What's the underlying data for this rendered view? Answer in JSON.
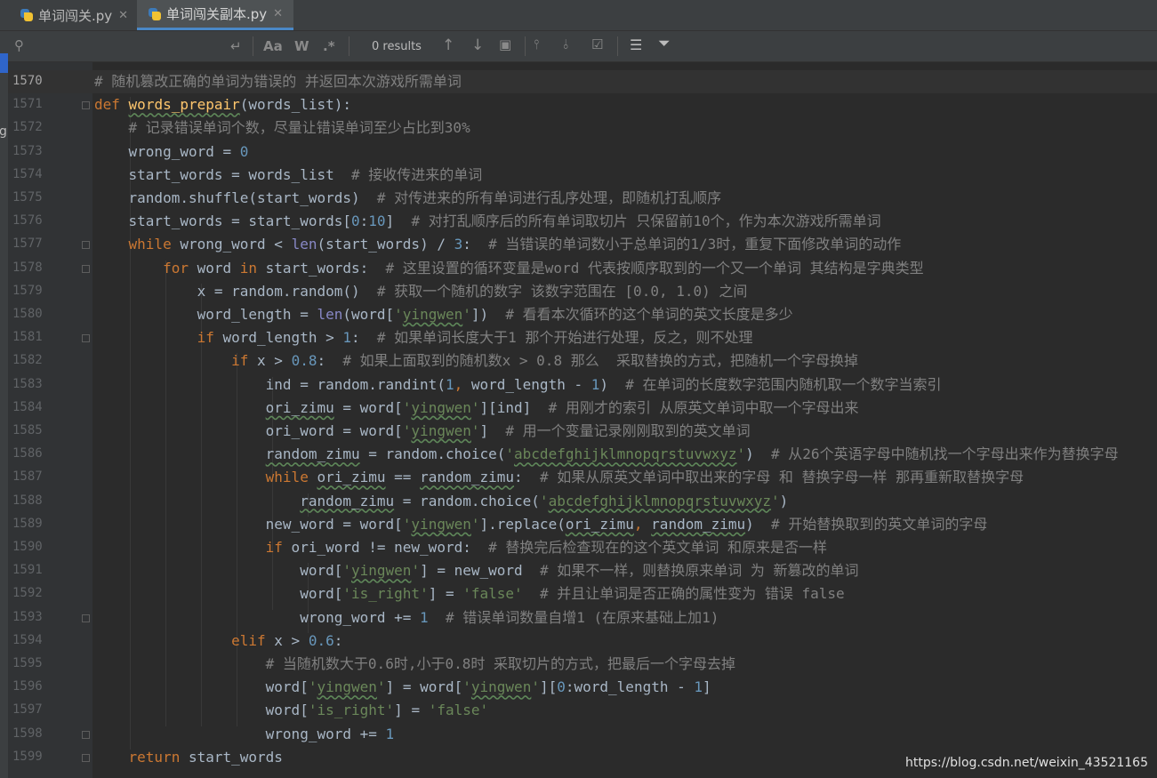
{
  "tabs": [
    {
      "label": "单词闯关.py",
      "active": false
    },
    {
      "label": "单词闯关副本.py",
      "active": true
    }
  ],
  "find": {
    "results": "0 results",
    "match_case": "Aa",
    "words": "W",
    "regex": ".*"
  },
  "left_strip_char": "g",
  "lines": [
    {
      "no": "1570",
      "code": "# 随机篡改正确的单词为错误的 并返回本次游戏所需单词"
    },
    {
      "no": "1571",
      "code": "def words_prepair(words_list):"
    },
    {
      "no": "1572",
      "code": "    # 记录错误单词个数，尽量让错误单词至少占比到30%"
    },
    {
      "no": "1573",
      "code": "    wrong_word = 0"
    },
    {
      "no": "1574",
      "code": "    start_words = words_list  # 接收传进来的单词"
    },
    {
      "no": "1575",
      "code": "    random.shuffle(start_words)  # 对传进来的所有单词进行乱序处理，即随机打乱顺序"
    },
    {
      "no": "1576",
      "code": "    start_words = start_words[0:10]  # 对打乱顺序后的所有单词取切片 只保留前10个，作为本次游戏所需单词"
    },
    {
      "no": "1577",
      "code": "    while wrong_word < len(start_words) / 3:  # 当错误的单词数小于总单词的1/3时，重复下面修改单词的动作"
    },
    {
      "no": "1578",
      "code": "        for word in start_words:  # 这里设置的循环变量是word 代表按顺序取到的一个又一个单词 其结构是字典类型"
    },
    {
      "no": "1579",
      "code": "            x = random.random()  # 获取一个随机的数字 该数字范围在 [0.0, 1.0) 之间"
    },
    {
      "no": "1580",
      "code": "            word_length = len(word['yingwen'])  # 看看本次循环的这个单词的英文长度是多少"
    },
    {
      "no": "1581",
      "code": "            if word_length > 1:  # 如果单词长度大于1 那个开始进行处理，反之，则不处理"
    },
    {
      "no": "1582",
      "code": "                if x > 0.8:  # 如果上面取到的随机数x > 0.8 那么  采取替换的方式，把随机一个字母换掉"
    },
    {
      "no": "1583",
      "code": "                    ind = random.randint(1, word_length - 1)  # 在单词的长度数字范围内随机取一个数字当索引"
    },
    {
      "no": "1584",
      "code": "                    ori_zimu = word['yingwen'][ind]  # 用刚才的索引 从原英文单词中取一个字母出来"
    },
    {
      "no": "1585",
      "code": "                    ori_word = word['yingwen']  # 用一个变量记录刚刚取到的英文单词"
    },
    {
      "no": "1586",
      "code": "                    random_zimu = random.choice('abcdefghijklmnopqrstuvwxyz')  # 从26个英语字母中随机找一个字母出来作为替换字母"
    },
    {
      "no": "1587",
      "code": "                    while ori_zimu == random_zimu:  # 如果从原英文单词中取出来的字母 和 替换字母一样 那再重新取替换字母"
    },
    {
      "no": "1588",
      "code": "                        random_zimu = random.choice('abcdefghijklmnopqrstuvwxyz')"
    },
    {
      "no": "1589",
      "code": "                    new_word = word['yingwen'].replace(ori_zimu, random_zimu)  # 开始替换取到的英文单词的字母"
    },
    {
      "no": "1590",
      "code": "                    if ori_word != new_word:  # 替换完后检查现在的这个英文单词 和原来是否一样"
    },
    {
      "no": "1591",
      "code": "                        word['yingwen'] = new_word  # 如果不一样，则替换原来单词 为 新篡改的单词"
    },
    {
      "no": "1592",
      "code": "                        word['is_right'] = 'false'  # 并且让单词是否正确的属性变为 错误 false"
    },
    {
      "no": "1593",
      "code": "                        wrong_word += 1  # 错误单词数量自增1 (在原来基础上加1)"
    },
    {
      "no": "1594",
      "code": "                elif x > 0.6:"
    },
    {
      "no": "1595",
      "code": "                    # 当随机数大于0.6时,小于0.8时 采取切片的方式，把最后一个字母去掉"
    },
    {
      "no": "1596",
      "code": "                    word['yingwen'] = word['yingwen'][0:word_length - 1]"
    },
    {
      "no": "1597",
      "code": "                    word['is_right'] = 'false'"
    },
    {
      "no": "1598",
      "code": "                    wrong_word += 1"
    },
    {
      "no": "1599",
      "code": "    return start_words"
    }
  ],
  "watermark": "https://blog.csdn.net/weixin_43521165",
  "colors": {
    "keyword": "#cc7832",
    "function": "#ffc66d",
    "comment": "#808080",
    "string": "#6a8759",
    "number": "#6897bb",
    "text": "#a9b7c6",
    "background": "#2b2b2b"
  }
}
